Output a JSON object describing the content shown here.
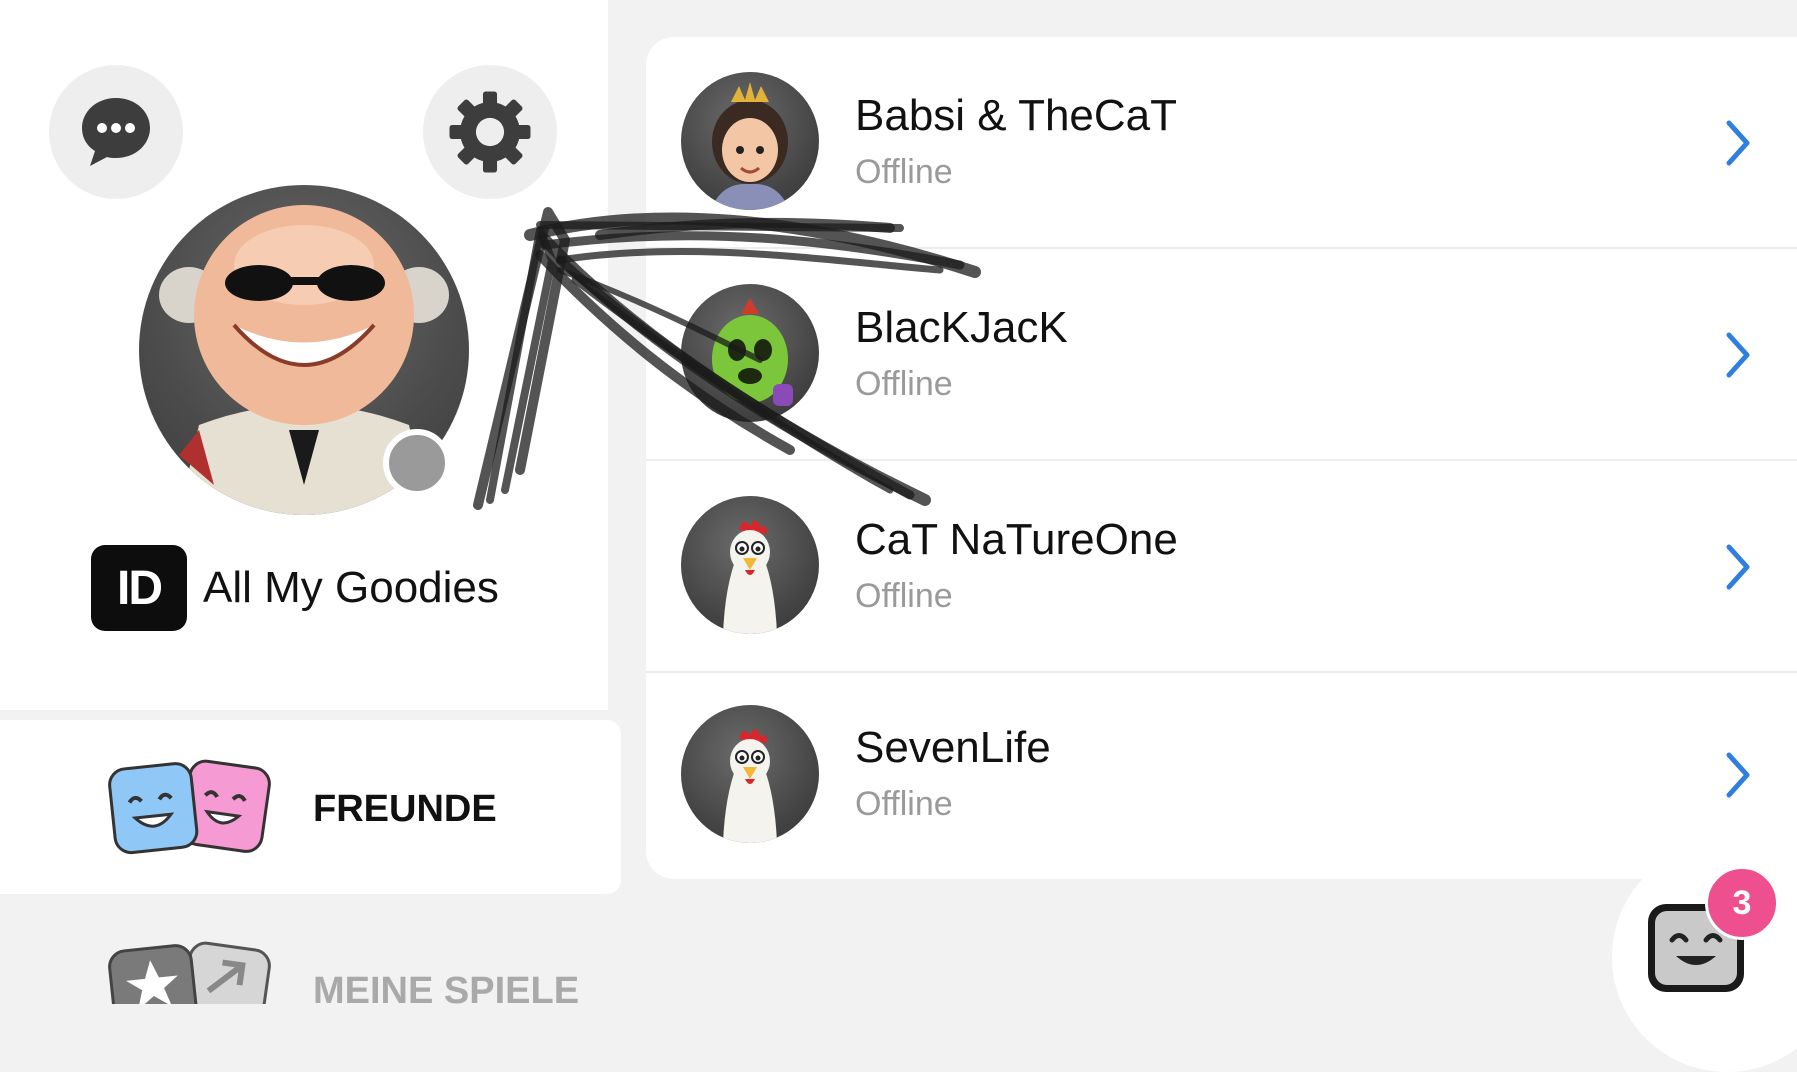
{
  "profile": {
    "name": "All My Goodies",
    "id_badge": "ID",
    "status_color": "#9a9a9a"
  },
  "nav": {
    "friends_label": "FREUNDE",
    "games_label": "MEINE SPIELE"
  },
  "friends": [
    {
      "name": "Babsi & TheCaT",
      "status": "Offline",
      "avatar": "princess-avatar"
    },
    {
      "name": "BlacKJacK",
      "status": "Offline",
      "avatar": "cactus-avatar"
    },
    {
      "name": "CaT NaTureOne",
      "status": "Offline",
      "avatar": "chicken-avatar"
    },
    {
      "name": "SevenLife",
      "status": "Offline",
      "avatar": "chicken-avatar"
    }
  ],
  "chat_fab": {
    "badge_count": "3"
  },
  "colors": {
    "accent_chevron": "#2f7fe0",
    "badge_pink": "#ee4f8f",
    "background": "#f2f2f2"
  }
}
